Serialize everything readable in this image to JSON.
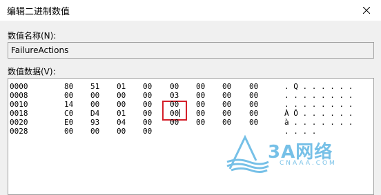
{
  "window": {
    "title": "编辑二进制数值",
    "close_symbol": "✕"
  },
  "value_name": {
    "label": "数值名称(N):",
    "value": "FailureActions"
  },
  "value_data": {
    "label": "数值数据(V):",
    "rows": [
      {
        "offset": "0000",
        "bytes": [
          "80",
          "51",
          "01",
          "00",
          "00",
          "00",
          "00",
          "00"
        ],
        "ascii": ". Q . . . . . ."
      },
      {
        "offset": "0008",
        "bytes": [
          "00",
          "00",
          "00",
          "00",
          "03",
          "00",
          "00",
          "00"
        ],
        "ascii": ". . . . . . . ."
      },
      {
        "offset": "0010",
        "bytes": [
          "14",
          "00",
          "00",
          "00",
          "00",
          "00",
          "00",
          "00"
        ],
        "ascii": ". . . . . . . ."
      },
      {
        "offset": "0018",
        "bytes": [
          "C0",
          "D4",
          "01",
          "00",
          "00",
          "00",
          "00",
          "00"
        ],
        "ascii": "À Ô . . . . . ."
      },
      {
        "offset": "0020",
        "bytes": [
          "E0",
          "93",
          "04",
          "00",
          "00",
          "00",
          "00",
          "00"
        ],
        "ascii": "à . . . . . . ."
      },
      {
        "offset": "0028",
        "bytes": [
          "00",
          "00",
          "00",
          "00"
        ],
        "ascii": ". . . ."
      }
    ],
    "highlighted_byte": {
      "row": 3,
      "col": 4,
      "value": "00"
    }
  },
  "watermark": {
    "main": "3A网络",
    "sub": "CNAAA.COM",
    "color": "#5fb6e3"
  }
}
